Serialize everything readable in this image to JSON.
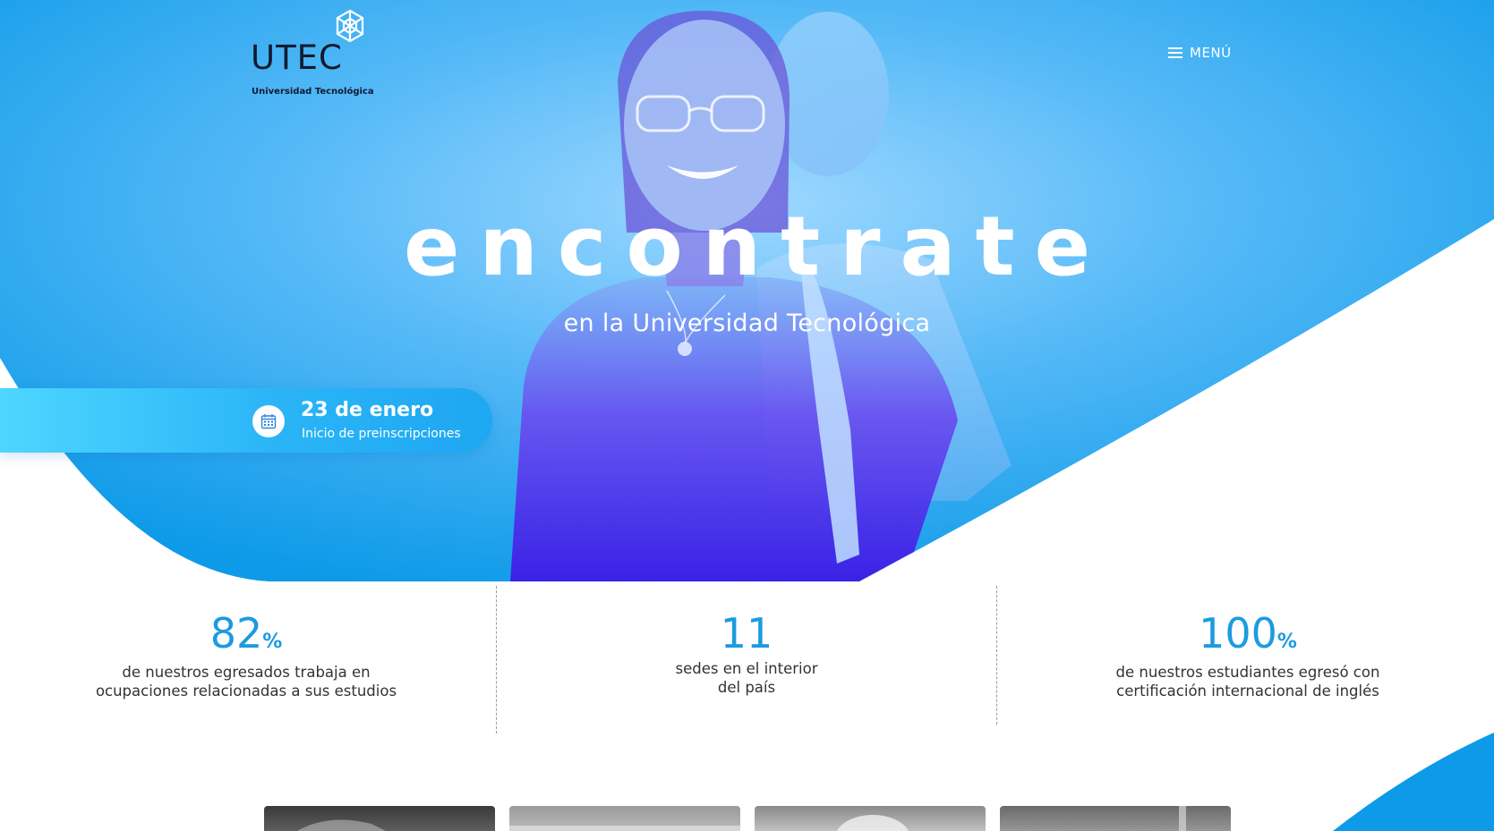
{
  "brand": {
    "name": "UTEC",
    "subtitle": "Universidad Tecnológica",
    "logo_icon": "utec-star-icon"
  },
  "nav": {
    "menu_label": "MENÚ",
    "menu_icon": "hamburger-icon"
  },
  "hero": {
    "headline": "encontrate",
    "subheadline": "en la Universidad Tecnológica",
    "event": {
      "icon": "calendar-icon",
      "date": "23 de enero",
      "description": "Inicio de preinscripciones"
    }
  },
  "stats": [
    {
      "value": "82",
      "unit": "%",
      "line1": "de nuestros egresados trabaja en",
      "line2": "ocupaciones relacionadas a sus estudios"
    },
    {
      "value": "11",
      "unit": "",
      "line1": "sedes en el interior",
      "line2": "del país"
    },
    {
      "value": "100",
      "unit": "%",
      "line1": "de nuestros estudiantes egresó con",
      "line2": "certificación internacional de inglés"
    }
  ],
  "thumbnails_count": 4,
  "colors": {
    "primary_blue": "#1b9be0",
    "hero_blue": "#17a2f0",
    "accent_purple": "#5a2df0",
    "pill_cyan": "#4dd6ff",
    "text_dark": "#111a2e"
  }
}
